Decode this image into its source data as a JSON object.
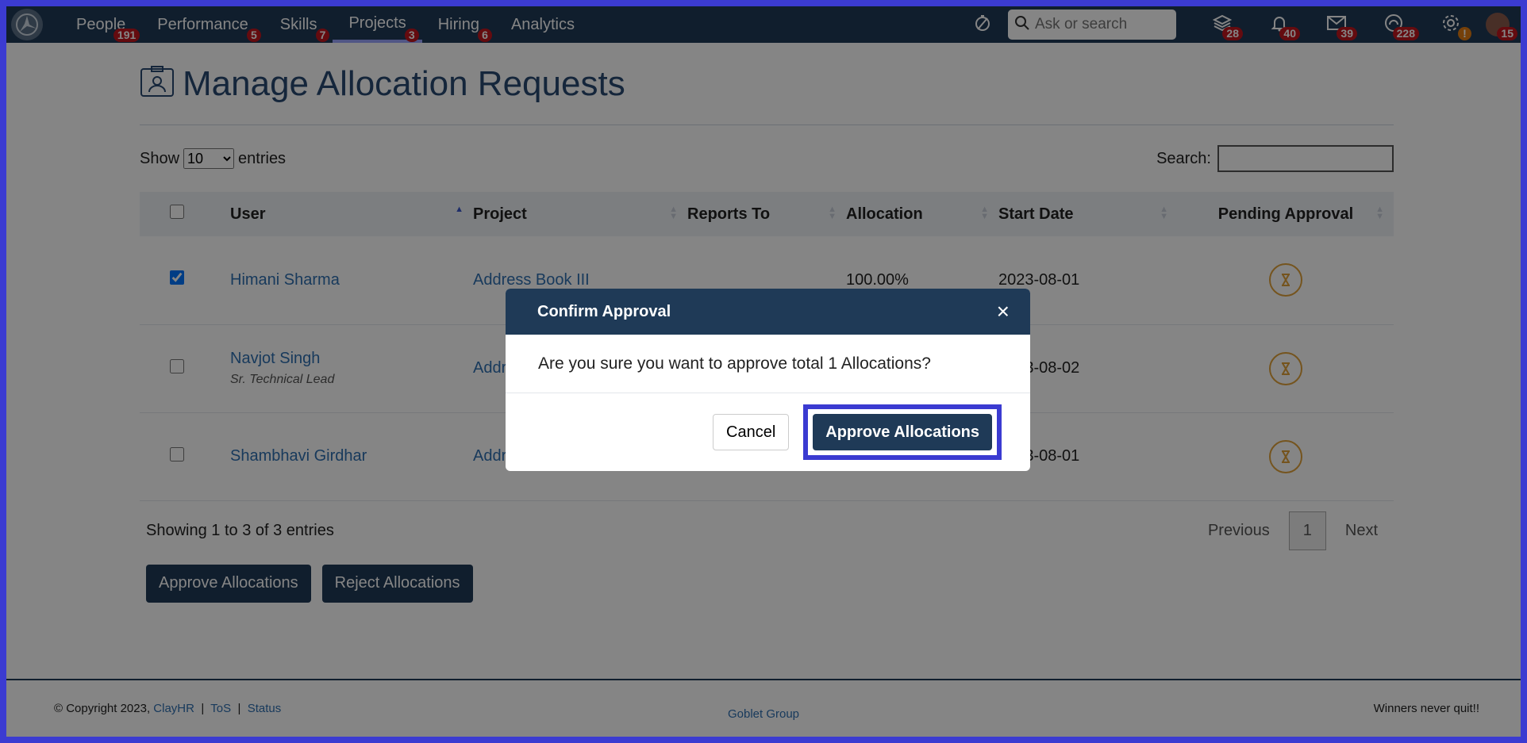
{
  "nav": {
    "items": [
      {
        "label": "People",
        "badge": "191"
      },
      {
        "label": "Performance",
        "badge": "5"
      },
      {
        "label": "Skills",
        "badge": "7"
      },
      {
        "label": "Projects",
        "badge": "3"
      },
      {
        "label": "Hiring",
        "badge": "6"
      },
      {
        "label": "Analytics",
        "badge": ""
      }
    ],
    "search_placeholder": "Ask or search",
    "icons": [
      {
        "name": "stack-icon",
        "badge": "28"
      },
      {
        "name": "bell-icon",
        "badge": "40"
      },
      {
        "name": "mail-icon",
        "badge": "39"
      },
      {
        "name": "support-icon",
        "badge": "228"
      },
      {
        "name": "gear-icon",
        "badge": "!"
      }
    ],
    "avatar_badge": "15"
  },
  "page": {
    "title": "Manage Allocation Requests",
    "show_label": "Show",
    "entries_label": "entries",
    "page_size": "10",
    "search_label": "Search:"
  },
  "table": {
    "headers": [
      "User",
      "Project",
      "Reports To",
      "Allocation",
      "Start Date",
      "Pending Approval"
    ],
    "rows": [
      {
        "user": "Himani Sharma",
        "title": "",
        "project": "Address Book III",
        "reports_to": "",
        "allocation": "100.00%",
        "start_date": "2023-08-01",
        "checked": true
      },
      {
        "user": "Navjot Singh",
        "title": "Sr. Technical Lead",
        "project": "Address Book III",
        "reports_to": "",
        "allocation": "",
        "start_date": "2023-08-02",
        "checked": false
      },
      {
        "user": "Shambhavi Girdhar",
        "title": "",
        "project": "Address Book III",
        "reports_to": "",
        "allocation": "",
        "start_date": "2023-08-01",
        "checked": false
      }
    ],
    "info": "Showing 1 to 3 of 3 entries",
    "previous": "Previous",
    "page": "1",
    "next": "Next"
  },
  "actions": {
    "approve": "Approve Allocations",
    "reject": "Reject Allocations"
  },
  "footer": {
    "copyright": "© Copyright 2023,",
    "brand": "ClayHR",
    "tos": "ToS",
    "status": "Status",
    "center": "Goblet Group",
    "tagline": "Winners never quit!!"
  },
  "modal": {
    "title": "Confirm Approval",
    "message": "Are you sure you want to approve total 1 Allocations?",
    "cancel": "Cancel",
    "approve": "Approve Allocations"
  },
  "colors": {
    "nav_bg": "#1f3a57",
    "accent_frame": "#3b3bd1",
    "link": "#2f6fb1",
    "badge_red": "#c0161e",
    "pending_orange": "#e0a23a"
  }
}
